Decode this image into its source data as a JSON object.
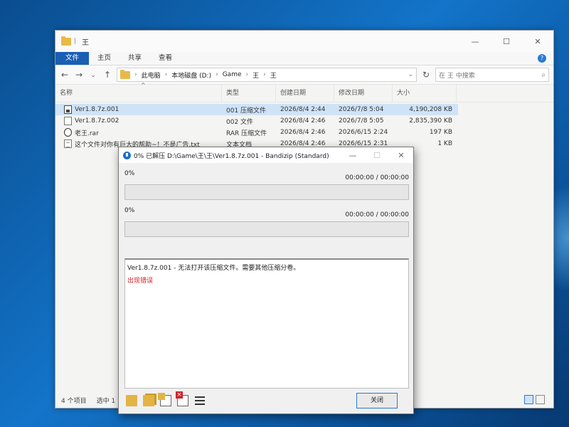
{
  "explorer": {
    "title": "王",
    "quick_access_sep": "|",
    "window_controls": [
      "—",
      "☐",
      "✕"
    ],
    "ribbon_tabs": [
      "文件",
      "主页",
      "共享",
      "查看"
    ],
    "help": "?",
    "path": [
      "此电脑",
      "本地磁盘 (D:)",
      "Game",
      "王",
      "王"
    ],
    "search_placeholder": "在 王 中搜索",
    "columns": {
      "name": "名称",
      "type": "类型",
      "created": "创建日期",
      "modified": "修改日期",
      "size": "大小"
    },
    "files": [
      {
        "name": "Ver1.8.7z.001",
        "type": "001 压缩文件",
        "created": "2026/8/4 2:44",
        "modified": "2026/7/8 5:04",
        "size": "4,190,208 KB",
        "icon": "archive-icon"
      },
      {
        "name": "Ver1.8.7z.002",
        "type": "002 文件",
        "created": "2026/8/4 2:46",
        "modified": "2026/7/8 5:05",
        "size": "2,835,390 KB",
        "icon": "file-icon"
      },
      {
        "name": "老王.rar",
        "type": "RAR 压缩文件",
        "created": "2026/8/4 2:46",
        "modified": "2026/6/15 2:24",
        "size": "197 KB",
        "icon": "rar-icon"
      },
      {
        "name": "这个文件对你有巨大的帮助~！不是广告.txt",
        "type": "文本文档",
        "created": "2026/8/4 2:46",
        "modified": "2026/6/15 2:31",
        "size": "1 KB",
        "icon": "text-file-icon"
      }
    ],
    "status": {
      "items": "4 个项目",
      "selected": "选中 1"
    }
  },
  "dialog": {
    "title": "0% 已解压 D:\\Game\\王\\王\\Ver1.8.7z.001 - Bandizip (Standard)",
    "window_controls": [
      "—",
      "☐",
      "✕"
    ],
    "progress1": {
      "percent_label": "0%",
      "time": "00:00:00 / 00:00:00",
      "value": 0
    },
    "progress2": {
      "percent_label": "0%",
      "time": "00:00:00 / 00:00:00",
      "value": 0
    },
    "log_message": "Ver1.8.7z.001 - 无法打开该压缩文件。需要其他压缩分卷。",
    "error_text": "出现错误",
    "error_color": "#d0202a",
    "tools": [
      "open-folder-icon",
      "extract-folder-icon",
      "copy-icon",
      "delete-icon",
      "menu-icon"
    ],
    "close_label": "关闭"
  }
}
